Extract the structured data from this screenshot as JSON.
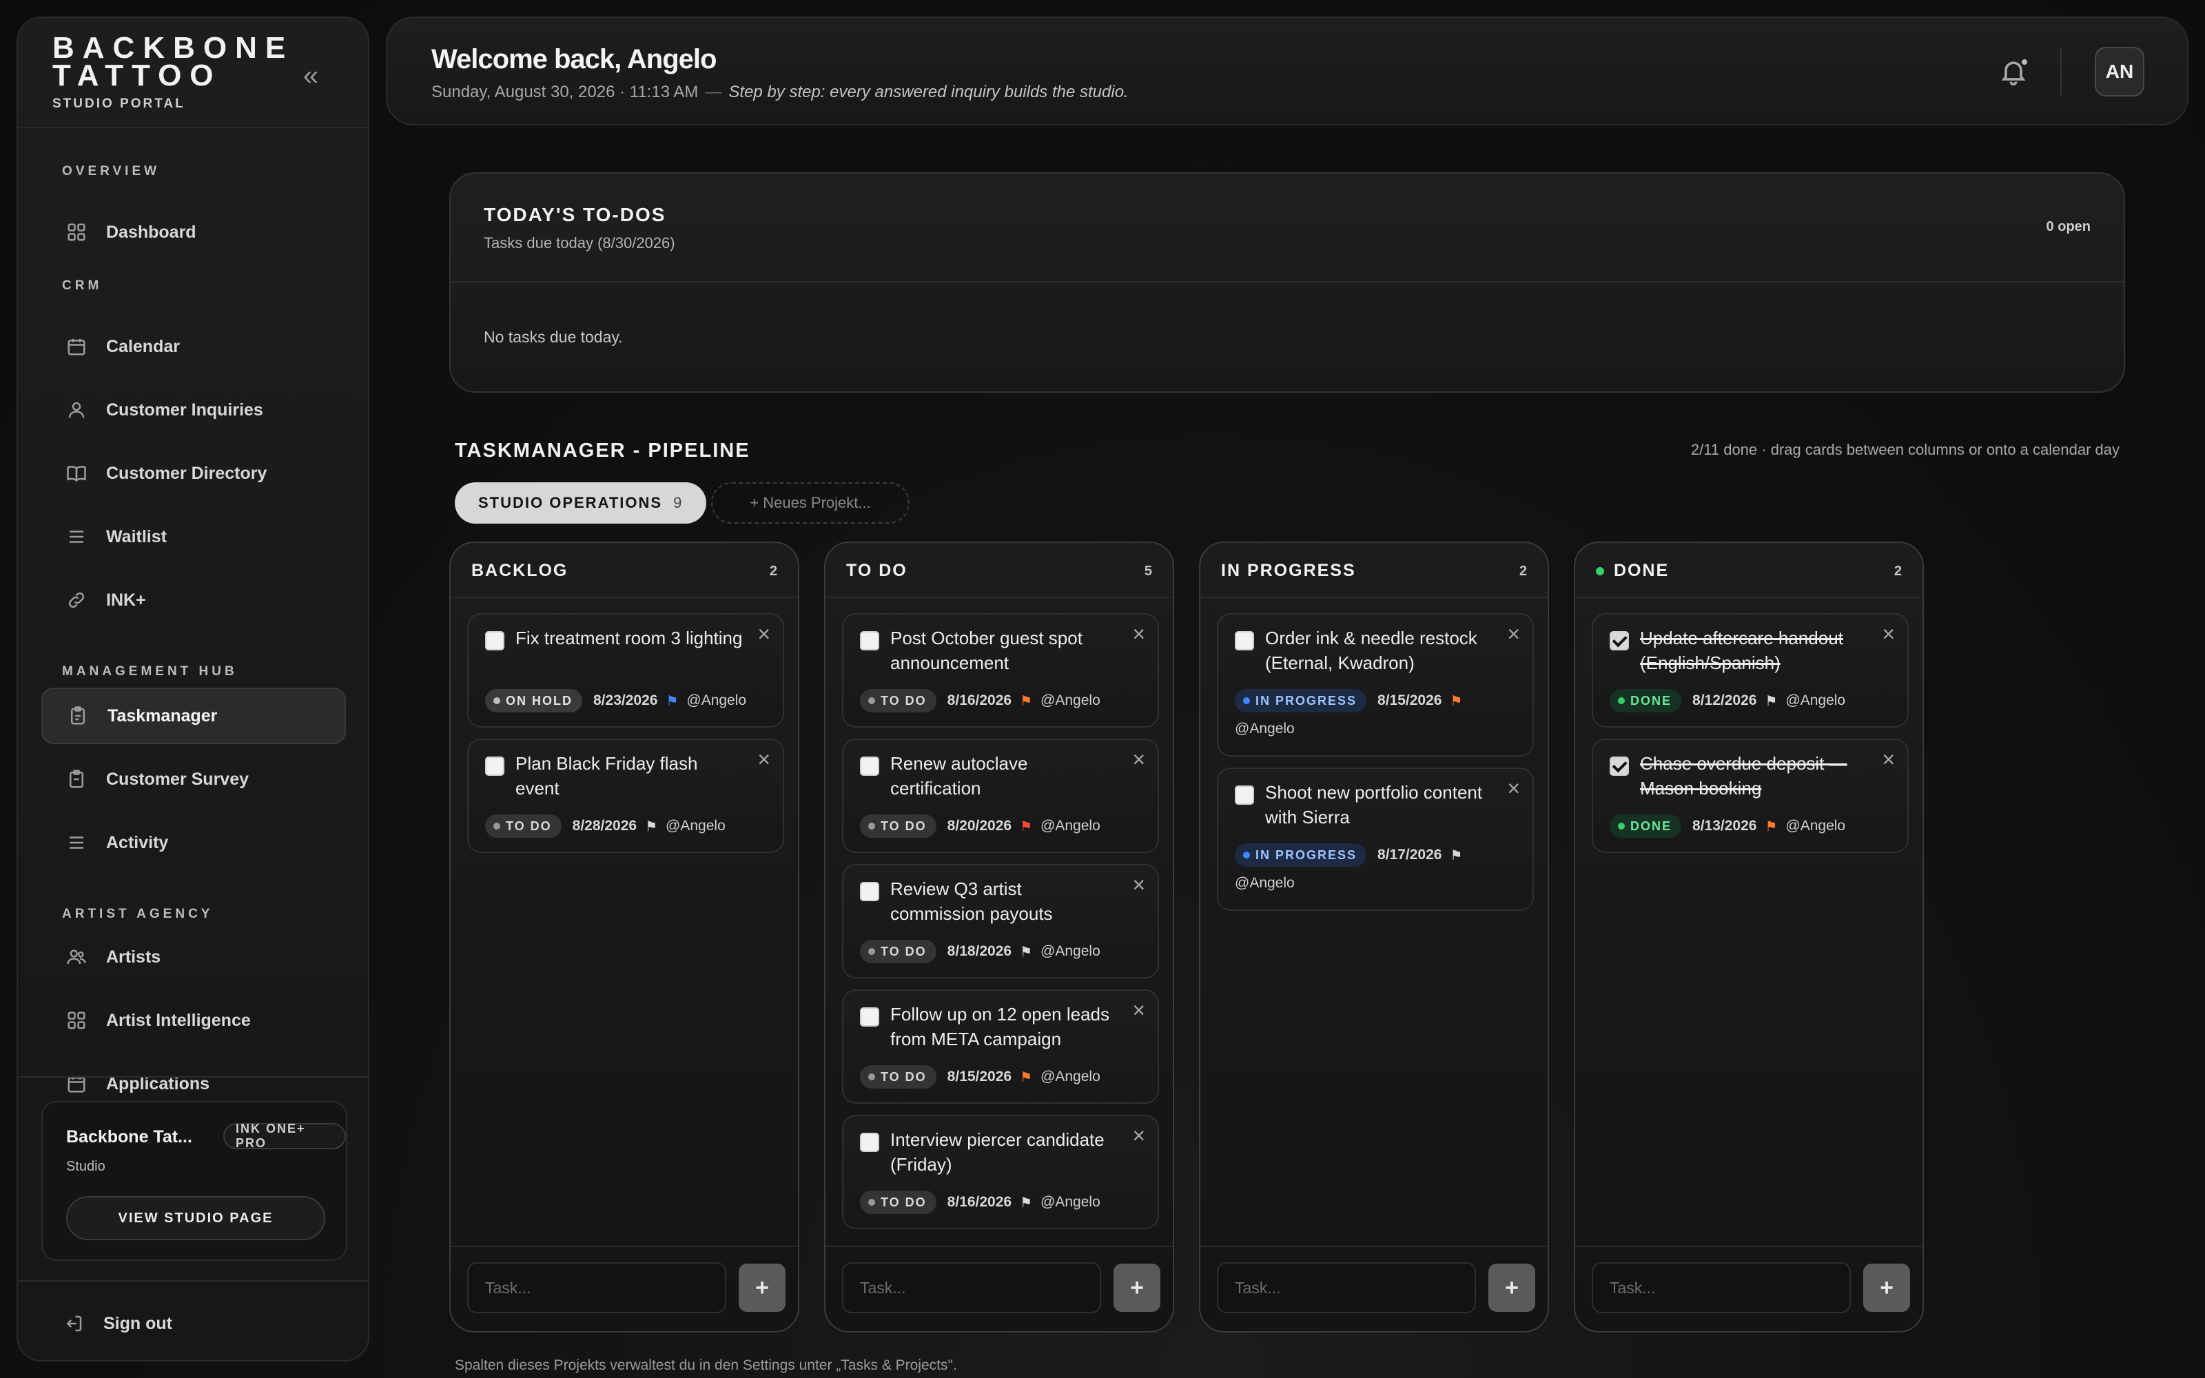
{
  "brand": {
    "name": "BACKBONE TATTOO",
    "subtitle": "STUDIO PORTAL"
  },
  "sidebar": {
    "sections": [
      {
        "label": "OVERVIEW"
      },
      {
        "label": "CRM"
      },
      {
        "label": "MANAGEMENT HUB"
      },
      {
        "label": "ARTIST AGENCY"
      }
    ],
    "items": [
      {
        "label": "Dashboard",
        "icon": "grid-icon"
      },
      {
        "label": "Calendar",
        "icon": "calendar-icon"
      },
      {
        "label": "Customer Inquiries",
        "icon": "user-icon"
      },
      {
        "label": "Customer Directory",
        "icon": "book-icon"
      },
      {
        "label": "Waitlist",
        "icon": "list-icon"
      },
      {
        "label": "INK+",
        "icon": "link-icon"
      },
      {
        "label": "Taskmanager",
        "icon": "clipboard-icon",
        "active": true
      },
      {
        "label": "Customer Survey",
        "icon": "clipboard-icon"
      },
      {
        "label": "Activity",
        "icon": "list-icon"
      },
      {
        "label": "Artists",
        "icon": "users-icon"
      },
      {
        "label": "Artist Intelligence",
        "icon": "grid-icon"
      },
      {
        "label": "Applications",
        "icon": "calendar-icon"
      }
    ],
    "studio": {
      "name": "Backbone Tat...",
      "plan": "INK ONE+ PRO",
      "role": "Studio",
      "view_button": "VIEW STUDIO PAGE"
    },
    "sign_out": "Sign out"
  },
  "header": {
    "welcome": "Welcome back, Angelo",
    "datetime": "Sunday, August 30, 2026 · 11:13 AM",
    "separator": "—",
    "motto": "Step by step: every answered inquiry builds the studio.",
    "avatar_initials": "AN"
  },
  "todos": {
    "title": "TODAY'S TO-DOS",
    "subtitle": "Tasks due today (8/30/2026)",
    "open_count": "0 open",
    "empty_text": "No tasks due today."
  },
  "pipeline": {
    "title": "TASKMANAGER - PIPELINE",
    "hint": "2/11 done · drag cards between columns or onto a calendar day",
    "project": {
      "label": "STUDIO OPERATIONS",
      "count": "9"
    },
    "new_project_label": "+ Neues Projekt...",
    "task_placeholder": "Task...",
    "add_label": "+",
    "columns": [
      {
        "title": "BACKLOG",
        "count": "2",
        "cards": [
          {
            "title": "Fix treatment room 3 lighting",
            "status": "ON HOLD",
            "status_key": "hold",
            "due": "8/23/2026",
            "flag_color": "#3f86ff",
            "assignee": "@Angelo",
            "checked": false
          },
          {
            "title": "Plan Black Friday flash event",
            "status": "TO DO",
            "status_key": "todo",
            "due": "8/28/2026",
            "flag_color": "#d8d8d8",
            "assignee": "@Angelo",
            "checked": false
          }
        ]
      },
      {
        "title": "TO DO",
        "count": "5",
        "cards": [
          {
            "title": "Post October guest spot announcement",
            "status": "TO DO",
            "status_key": "todo",
            "due": "8/16/2026",
            "flag_color": "#ff7a2a",
            "assignee": "@Angelo",
            "checked": false
          },
          {
            "title": "Renew autoclave certification",
            "status": "TO DO",
            "status_key": "todo",
            "due": "8/20/2026",
            "flag_color": "#ff4a3a",
            "assignee": "@Angelo",
            "checked": false
          },
          {
            "title": "Review Q3 artist commission payouts",
            "status": "TO DO",
            "status_key": "todo",
            "due": "8/18/2026",
            "flag_color": "#d8d8d8",
            "assignee": "@Angelo",
            "checked": false
          },
          {
            "title": "Follow up on 12 open leads from META campaign",
            "status": "TO DO",
            "status_key": "todo",
            "due": "8/15/2026",
            "flag_color": "#ff7a2a",
            "assignee": "@Angelo",
            "checked": false
          },
          {
            "title": "Interview piercer candidate (Friday)",
            "status": "TO DO",
            "status_key": "todo",
            "due": "8/16/2026",
            "flag_color": "#d8d8d8",
            "assignee": "@Angelo",
            "checked": false
          }
        ]
      },
      {
        "title": "IN PROGRESS",
        "count": "2",
        "cards": [
          {
            "title": "Order ink & needle restock (Eternal, Kwadron)",
            "status": "IN PROGRESS",
            "status_key": "prog",
            "due": "8/15/2026",
            "flag_color": "#ff7a2a",
            "assignee": "@Angelo",
            "checked": false
          },
          {
            "title": "Shoot new portfolio content with Sierra",
            "status": "IN PROGRESS",
            "status_key": "prog",
            "due": "8/17/2026",
            "flag_color": "#d8d8d8",
            "assignee": "@Angelo",
            "checked": false
          }
        ]
      },
      {
        "title": "DONE",
        "count": "2",
        "dot_color": "#35d06a",
        "cards": [
          {
            "title": "Update aftercare handout (English/Spanish)",
            "status": "DONE",
            "status_key": "done",
            "due": "8/12/2026",
            "flag_color": "#d8d8d8",
            "assignee": "@Angelo",
            "checked": true
          },
          {
            "title": "Chase overdue deposit — Mason booking",
            "status": "DONE",
            "status_key": "done",
            "due": "8/13/2026",
            "flag_color": "#ff7a2a",
            "assignee": "@Angelo",
            "checked": true
          }
        ]
      }
    ],
    "footnote": "Spalten dieses Projekts verwaltest du in den Settings unter „Tasks & Projects\"."
  }
}
